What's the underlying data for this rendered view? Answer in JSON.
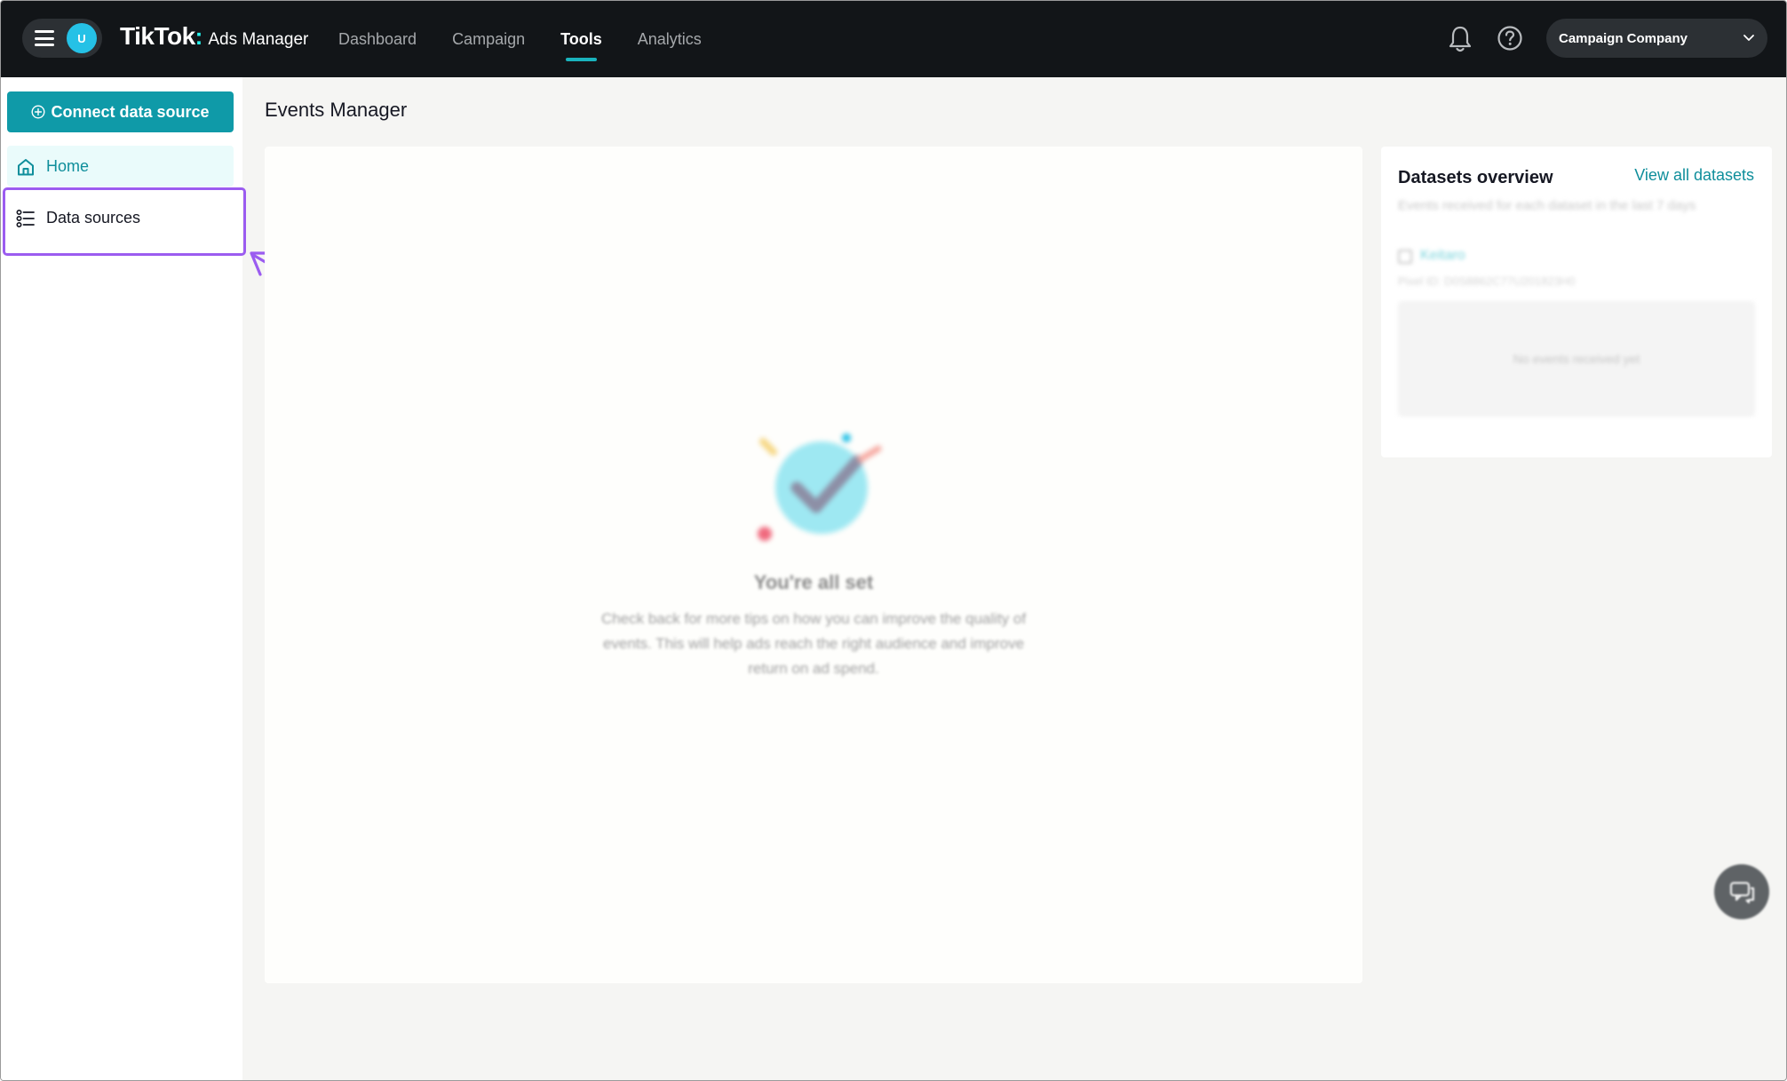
{
  "topbar": {
    "avatar_letter": "U",
    "brand": "TikTok",
    "product": "Ads Manager",
    "nav": [
      "Dashboard",
      "Campaign",
      "Tools",
      "Analytics"
    ],
    "active_nav": "Tools",
    "account": "Campaign Company",
    "icons": [
      "menu-icon",
      "bell-icon",
      "help-icon",
      "chevron-down-icon"
    ]
  },
  "sidebar": {
    "connect_button": "Connect data source",
    "items": [
      {
        "label": "Home",
        "icon": "home-icon",
        "active": true
      },
      {
        "label": "Data sources",
        "icon": "list-icon",
        "active": false
      }
    ]
  },
  "main": {
    "title": "Events Manager",
    "empty_state": {
      "title": "You're all set",
      "description": "Check back for more tips on how you can improve the quality of events. This will help ads reach the right audience and improve return on ad spend."
    }
  },
  "datasets": {
    "title": "Datasets overview",
    "link": "View all datasets",
    "subtitle": "Events received for each dataset in the last 7 days",
    "dataset_name": "Keitaro",
    "pixel_id": "Pixel ID: D0S8862C77U201823H0",
    "empty": "No events received yet"
  },
  "colors": {
    "accent": "#0f9aa8",
    "highlight": "#9b5cf0",
    "topbar": "#121518"
  }
}
